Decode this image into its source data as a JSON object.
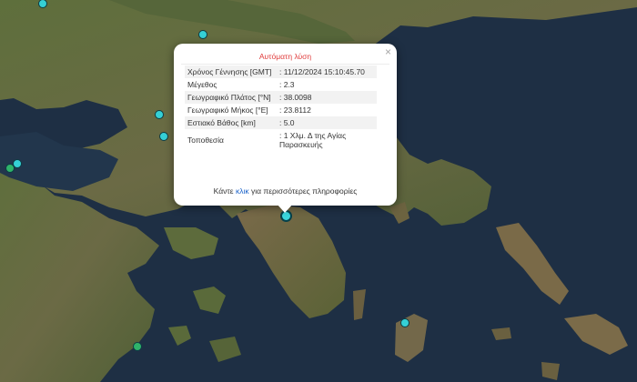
{
  "popup": {
    "title": "Αυτόματη λύση",
    "close_symbol": "×",
    "rows": [
      {
        "label": "Χρόνος Γέννησης [GMT]",
        "value": ": 11/12/2024 15:10:45.70"
      },
      {
        "label": "Μέγεθος",
        "value": ": 2.3"
      },
      {
        "label": "Γεωγραφικό Πλάτος [°N]",
        "value": ": 38.0098"
      },
      {
        "label": "Γεωγραφικό Μήκος [°E]",
        "value": ": 23.8112"
      },
      {
        "label": "Εστιακό Βάθος [km]",
        "value": ": 5.0"
      },
      {
        "label": "Τοποθεσία",
        "value": ": 1 Χλμ. Δ της Αγίας Παρασκευής"
      }
    ],
    "footer_prefix": "Κάντε",
    "footer_link": "κλικ",
    "footer_suffix": "για περισσότερες πληροφορίες"
  },
  "colors": {
    "sea": "#1f3045",
    "land": "#5a6a3a",
    "popup_title": "#e03b3b",
    "link": "#1a62c9",
    "marker": "#35d0d6"
  }
}
